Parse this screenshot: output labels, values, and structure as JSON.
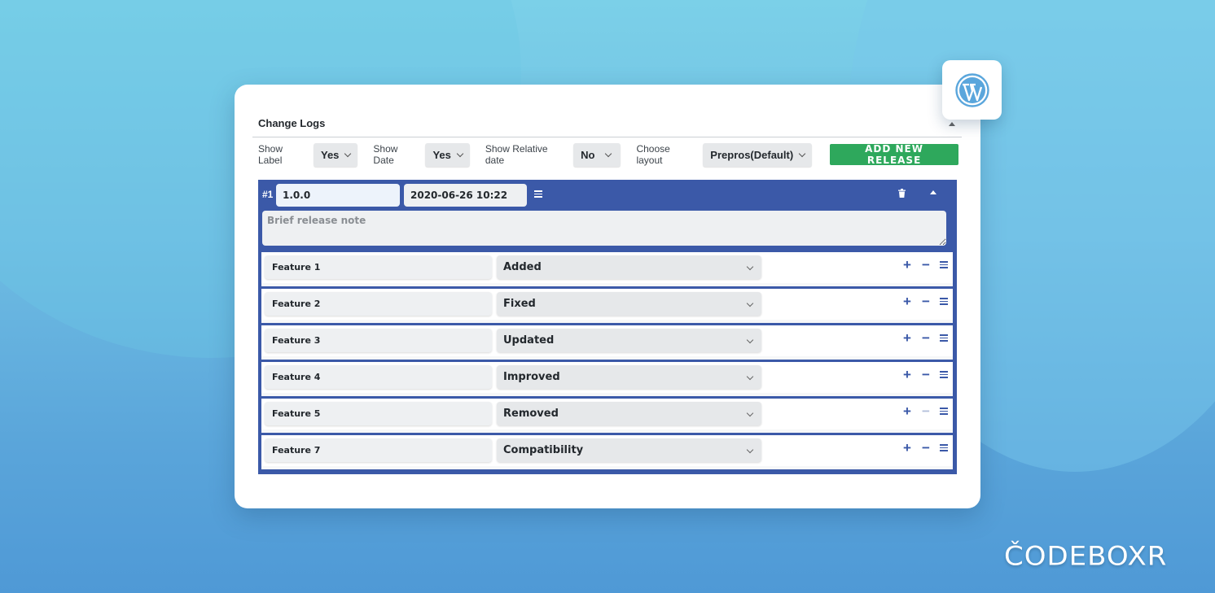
{
  "panel": {
    "title": "Change Logs"
  },
  "toolbar": {
    "show_label": {
      "label": "Show Label",
      "value": "Yes"
    },
    "show_date": {
      "label": "Show Date",
      "value": "Yes"
    },
    "show_relative_date": {
      "label": "Show Relative date",
      "value": "No"
    },
    "choose_layout": {
      "label": "Choose layout",
      "value": "Prepros(Default)"
    },
    "add_release_label": "ADD NEW RELEASE"
  },
  "release": {
    "number": "#1",
    "version": "1.0.0",
    "date": "2020-06-26 10:22",
    "note_placeholder": "Brief release note",
    "features": [
      {
        "name": "Feature 1",
        "type": "Added",
        "remove_enabled": true
      },
      {
        "name": "Feature 2",
        "type": "Fixed",
        "remove_enabled": true
      },
      {
        "name": "Feature 3",
        "type": "Updated",
        "remove_enabled": true
      },
      {
        "name": "Feature 4",
        "type": "Improved",
        "remove_enabled": true
      },
      {
        "name": "Feature 5",
        "type": "Removed",
        "remove_enabled": false
      },
      {
        "name": "Feature 7",
        "type": "Compatibility",
        "remove_enabled": true
      }
    ]
  },
  "icons": {
    "add": "+",
    "remove": "−"
  },
  "brand": {
    "logo_text": "ČODEBOXR"
  },
  "colors": {
    "accent_blue": "#3b59a8",
    "button_green": "#2ea85c",
    "wordpress_blue": "#5aa6dc"
  }
}
